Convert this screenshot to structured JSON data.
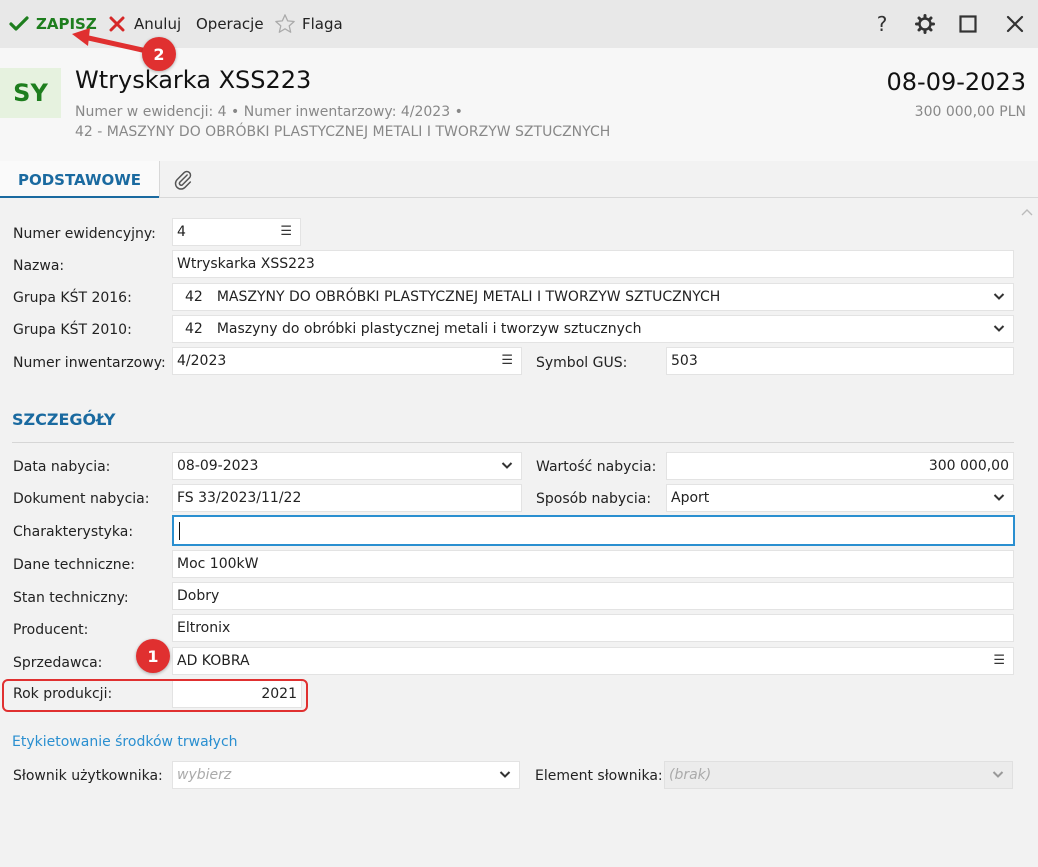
{
  "toolbar": {
    "save_label": "ZAPISZ",
    "cancel_label": "Anuluj",
    "operations_label": "Operacje",
    "flag_label": "Flaga",
    "help_icon": "?",
    "colors": {
      "save": "#1e7e1e",
      "cancel": "#d62828"
    }
  },
  "header": {
    "avatar": "SY",
    "title": "Wtryskarka XSS223",
    "subtitle1": "Numer w ewidencji: 4  •  Numer inwentarzowy: 4/2023  •",
    "subtitle2": "42 - MASZYNY DO OBRÓBKI PLASTYCZNEJ METALI I TWORZYW SZTUCZNYCH",
    "date": "08-09-2023",
    "amount": "300 000,00 PLN"
  },
  "tabs": [
    {
      "label": "PODSTAWOWE",
      "active": true
    },
    {
      "label": "",
      "icon": "paperclip-icon"
    }
  ],
  "basic": {
    "numer_ewid_label": "Numer ewidencyjny:",
    "numer_ewid_value": "4",
    "nazwa_label": "Nazwa:",
    "nazwa_value": "Wtryskarka XSS223",
    "kst2016_label": "Grupa KŚT 2016:",
    "kst2016_code": "42",
    "kst2016_value": "MASZYNY DO OBRÓBKI PLASTYCZNEJ METALI I TWORZYW SZTUCZNYCH",
    "kst2010_label": "Grupa KŚT 2010:",
    "kst2010_code": "42",
    "kst2010_value": "Maszyny do obróbki plastycznej metali i tworzyw sztucznych",
    "numer_inw_label": "Numer inwentarzowy:",
    "numer_inw_value": "4/2023",
    "gus_label": "Symbol GUS:",
    "gus_value": "503"
  },
  "details": {
    "section_title": "SZCZEGÓŁY",
    "data_nabycia_label": "Data nabycia:",
    "data_nabycia_value": "08-09-2023",
    "wartosc_label": "Wartość nabycia:",
    "wartosc_value": "300 000,00",
    "dokument_label": "Dokument nabycia:",
    "dokument_value": "FS 33/2023/11/22",
    "sposob_label": "Sposób nabycia:",
    "sposob_value": "Aport",
    "charakterystyka_label": "Charakterystyka:",
    "charakterystyka_value": "",
    "dane_tech_label": "Dane techniczne:",
    "dane_tech_value": "Moc 100kW",
    "stan_label": "Stan techniczny:",
    "stan_value": "Dobry",
    "producent_label": "Producent:",
    "producent_value": "Eltronix",
    "sprzedawca_label": "Sprzedawca:",
    "sprzedawca_value": "AD KOBRA",
    "rok_label": "Rok produkcji:",
    "rok_value": "2021"
  },
  "labels_section": {
    "link": "Etykietowanie środków trwałych",
    "slownik_label": "Słownik użytkownika:",
    "slownik_placeholder": "wybierz",
    "element_label": "Element słownika:",
    "element_placeholder": "(brak)"
  },
  "annotations": {
    "badge1": "1",
    "badge2": "2",
    "color": "#e03030"
  }
}
